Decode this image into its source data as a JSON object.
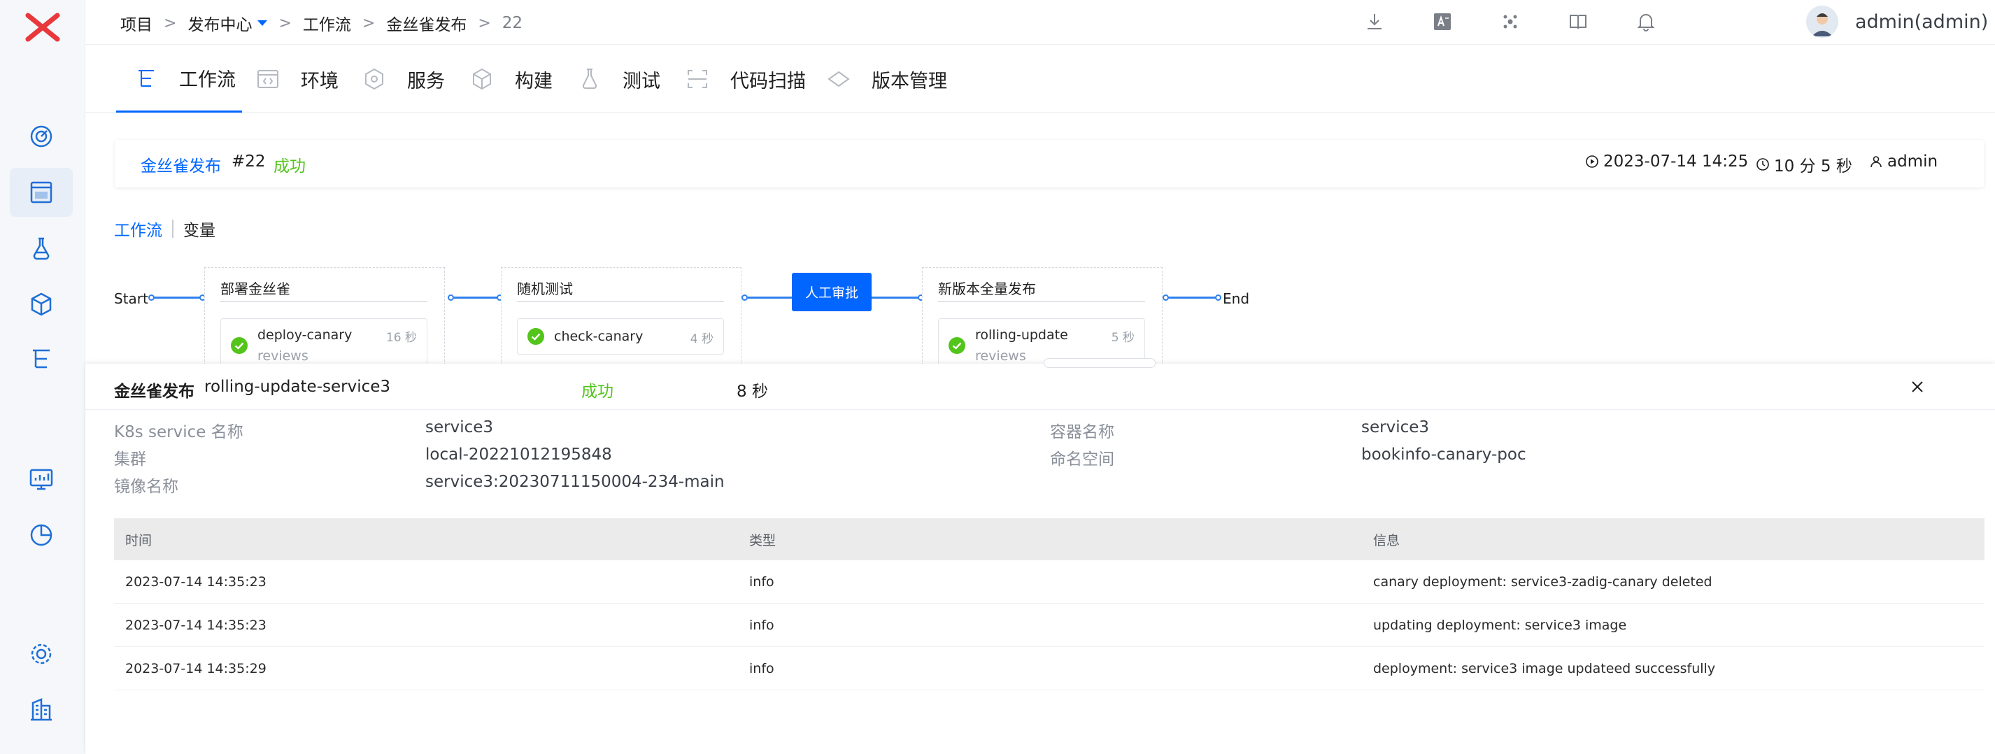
{
  "colors": {
    "accent": "#0066ff",
    "success": "#52c41a",
    "brand": "#e8383d"
  },
  "breadcrumb": {
    "items": [
      "项目",
      "发布中心",
      "工作流",
      "金丝雀发布",
      "22"
    ],
    "separator": ">"
  },
  "topbar": {
    "icons": [
      "download-icon",
      "translate-icon",
      "apps-icon",
      "book-icon",
      "bell-icon"
    ],
    "user": "admin(admin)"
  },
  "tabs": [
    {
      "label": "工作流",
      "icon": "workflow-icon"
    },
    {
      "label": "环境",
      "icon": "environment-icon"
    },
    {
      "label": "服务",
      "icon": "service-icon"
    },
    {
      "label": "构建",
      "icon": "build-icon"
    },
    {
      "label": "测试",
      "icon": "test-icon"
    },
    {
      "label": "代码扫描",
      "icon": "code-scan-icon"
    },
    {
      "label": "版本管理",
      "icon": "version-icon"
    }
  ],
  "summary": {
    "name": "金丝雀发布",
    "number": "#22",
    "status": "成功",
    "start_time": "2023-07-14 14:25",
    "duration": "10 分 5 秒",
    "creator": "admin"
  },
  "subtabs": {
    "workflow": "工作流",
    "variables": "变量"
  },
  "pipeline": {
    "start": "Start",
    "end": "End",
    "stages": [
      {
        "title": "部署金丝雀",
        "job": {
          "name": "deploy-canary",
          "sub": "reviews",
          "time": "16 秒"
        }
      },
      {
        "title": "随机测试",
        "job": {
          "name": "check-canary",
          "sub": "",
          "time": "4 秒"
        }
      },
      {
        "title": "新版本全量发布",
        "job": {
          "name": "rolling-update",
          "sub": "reviews",
          "time": "5 秒"
        }
      }
    ],
    "approval": "人工审批"
  },
  "detail": {
    "title": "金丝雀发布",
    "job": "rolling-update-service3",
    "status": "成功",
    "duration": "8 秒",
    "info": {
      "k8s_service_label": "K8s service 名称",
      "k8s_service_value": "service3",
      "container_label": "容器名称",
      "container_value": "service3",
      "cluster_label": "集群",
      "cluster_value": "local-20221012195848",
      "namespace_label": "命名空间",
      "namespace_value": "bookinfo-canary-poc",
      "image_label": "镜像名称",
      "image_value": "service3:20230711150004-234-main"
    },
    "table": {
      "headers": [
        "时间",
        "类型",
        "信息"
      ],
      "rows": [
        [
          "2023-07-14 14:35:23",
          "info",
          "canary deployment: service3-zadig-canary deleted"
        ],
        [
          "2023-07-14 14:35:23",
          "info",
          "updating deployment: service3 image"
        ],
        [
          "2023-07-14 14:35:29",
          "info",
          "deployment: service3 image updateed successfully"
        ]
      ]
    }
  }
}
